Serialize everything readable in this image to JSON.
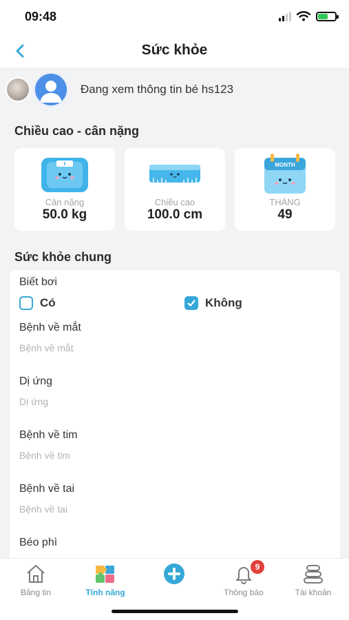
{
  "status_bar": {
    "time": "09:48"
  },
  "header": {
    "title": "Sức khỏe"
  },
  "student": {
    "viewing_text": "Đang xem thông tin bé  hs123"
  },
  "height_weight": {
    "title": "Chiều cao - cân nặng",
    "cards": [
      {
        "label": "Cân nặng",
        "value": "50.0 kg",
        "icon": "scale-icon"
      },
      {
        "label": "Chiều cao",
        "value": "100.0 cm",
        "icon": "ruler-icon"
      },
      {
        "label": "THÁNG",
        "value": "49",
        "icon": "calendar-icon",
        "icon_text": "MONTH"
      }
    ]
  },
  "general_health": {
    "title": "Sức khỏe chung",
    "swimming": {
      "label": "Biết bơi",
      "options": [
        {
          "label": "Có",
          "checked": false
        },
        {
          "label": "Không",
          "checked": true
        }
      ]
    },
    "fields": [
      {
        "label": "Bệnh về mắt",
        "placeholder": "Bệnh về mắt"
      },
      {
        "label": "Dị ứng",
        "placeholder": "Dị ứng"
      },
      {
        "label": "Bệnh về tim",
        "placeholder": "Bệnh về tim"
      },
      {
        "label": "Bệnh về tai",
        "placeholder": "Bệnh về tai"
      },
      {
        "label": "Béo phì",
        "placeholder": ""
      }
    ]
  },
  "tabbar": {
    "items": [
      {
        "label": "Bảng tin",
        "icon": "house-icon"
      },
      {
        "label": "Tính năng",
        "icon": "puzzle-icon",
        "active": true
      },
      {
        "label": "",
        "icon": "add-icon"
      },
      {
        "label": "Thông báo",
        "icon": "bell-icon",
        "badge": "9"
      },
      {
        "label": "Tài khoản",
        "icon": "account-icon"
      }
    ]
  },
  "colors": {
    "accent": "#35a8d8",
    "badge": "#e2403c",
    "background": "#f2f3f5"
  }
}
